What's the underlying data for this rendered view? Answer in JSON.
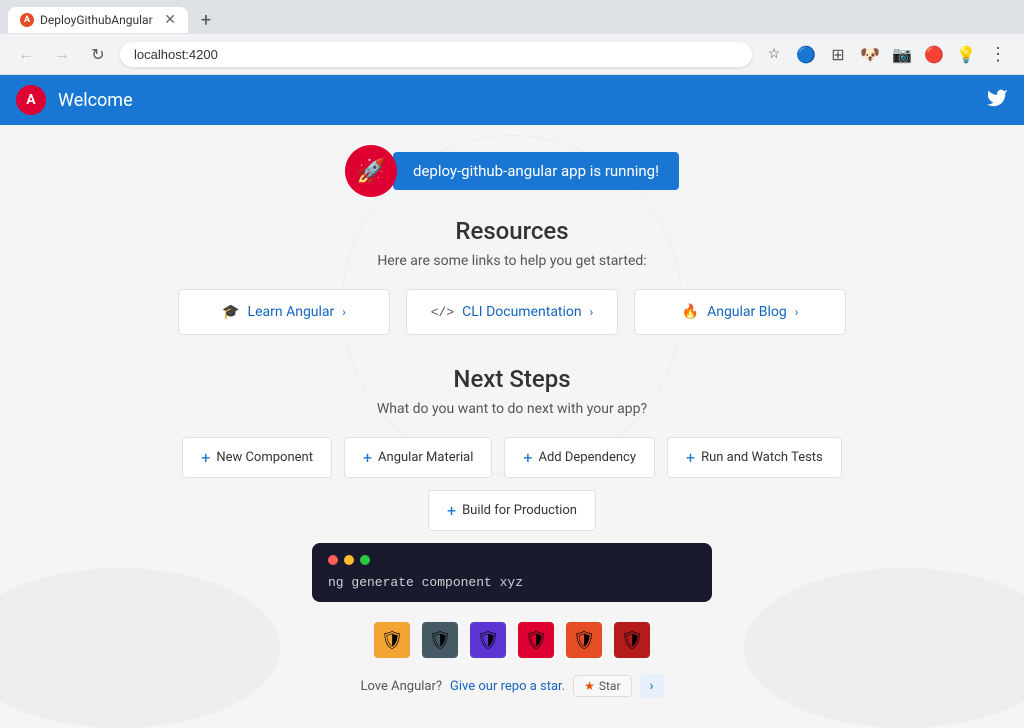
{
  "browser": {
    "tab_title": "DeployGithubAngular",
    "url": "localhost:4200",
    "new_tab_label": "+"
  },
  "header": {
    "logo_letter": "A",
    "title": "Welcome",
    "twitter_symbol": "🐦"
  },
  "banner": {
    "text": "deploy-github-angular app is running!",
    "rocket_symbol": "🚀"
  },
  "resources": {
    "title": "Resources",
    "subtitle": "Here are some links to help you get started:",
    "cards": [
      {
        "icon": "🎓",
        "label": "Learn Angular",
        "chevron": "›"
      },
      {
        "icon": "<>",
        "label": "CLI Documentation",
        "chevron": "›"
      },
      {
        "icon": "🔥",
        "label": "Angular Blog",
        "chevron": "›"
      }
    ]
  },
  "next_steps": {
    "title": "Next Steps",
    "subtitle": "What do you want to do next with your app?",
    "cards": [
      {
        "label": "New Component"
      },
      {
        "label": "Angular Material"
      },
      {
        "label": "Add Dependency"
      },
      {
        "label": "Run and Watch Tests"
      },
      {
        "label": "Build for Production"
      }
    ]
  },
  "terminal": {
    "code": "ng generate component xyz"
  },
  "star_section": {
    "text": "Love Angular?",
    "link_text": "Give our repo a star.",
    "star_symbol": "★",
    "star_label": "Star",
    "arrow": "›"
  },
  "extensions": [
    {
      "color": "#f4a435",
      "symbol": "🛡"
    },
    {
      "color": "#455a64",
      "symbol": "🛡"
    },
    {
      "color": "#5c35d4",
      "symbol": "🛡"
    },
    {
      "color": "#dd0031",
      "symbol": "🛡"
    },
    {
      "color": "#e44d26",
      "symbol": "🛡"
    },
    {
      "color": "#b71c1c",
      "symbol": "🛡"
    }
  ]
}
